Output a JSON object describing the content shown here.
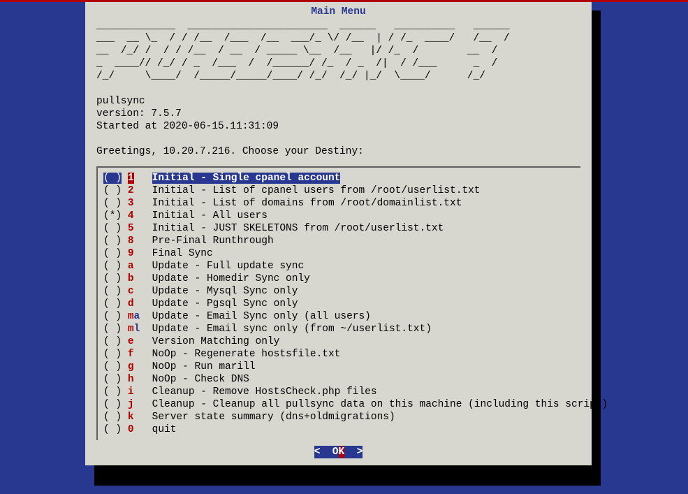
{
  "title": "Main Menu",
  "ascii": [
    "_____________  _______________________  ______   __________   ______",
    "___  __ \\_  / / /__  /___  /__  ___/_ \\/ /__  | / /_  ____/   /__  /",
    "__  /_/ /  / / /__  / __  / _____ \\__  /__   |/ /_  /        __  / ",
    "_  ____// /_/ / _  /___  /  /______/ /_  / _  /|  / /___      _  /  ",
    "/_/     \\____/  /_____/_____/____/ /_/  /_/ |_/  \\____/      /_/   "
  ],
  "app_name": "pullsync",
  "version_label": "version: 7.5.7",
  "started_label": "Started at 2020-06-15.11:31:09",
  "greeting": "Greetings, 10.20.7.216. Choose your Destiny:",
  "menu": [
    {
      "key": "1",
      "key2": "",
      "desc": "Initial - Single cpanel account",
      "selected": true,
      "marked": false
    },
    {
      "key": "2",
      "key2": "",
      "desc": "Initial - List of cpanel users from /root/userlist.txt",
      "selected": false,
      "marked": false
    },
    {
      "key": "3",
      "key2": "",
      "desc": "Initial - List of domains from /root/domainlist.txt",
      "selected": false,
      "marked": false
    },
    {
      "key": "4",
      "key2": "",
      "desc": "Initial - All users",
      "selected": false,
      "marked": true
    },
    {
      "key": "5",
      "key2": "",
      "desc": "Initial - JUST SKELETONS from /root/userlist.txt",
      "selected": false,
      "marked": false
    },
    {
      "key": "8",
      "key2": "",
      "desc": "Pre-Final Runthrough",
      "selected": false,
      "marked": false
    },
    {
      "key": "9",
      "key2": "",
      "desc": "Final Sync",
      "selected": false,
      "marked": false
    },
    {
      "key": "a",
      "key2": "",
      "desc": "Update - Full update sync",
      "selected": false,
      "marked": false
    },
    {
      "key": "b",
      "key2": "",
      "desc": "Update - Homedir Sync only",
      "selected": false,
      "marked": false
    },
    {
      "key": "c",
      "key2": "",
      "desc": "Update - Mysql Sync only",
      "selected": false,
      "marked": false
    },
    {
      "key": "d",
      "key2": "",
      "desc": "Update - Pgsql Sync only",
      "selected": false,
      "marked": false
    },
    {
      "key": "m",
      "key2": "a",
      "desc": "Update - Email Sync only (all users)",
      "selected": false,
      "marked": false
    },
    {
      "key": "m",
      "key2": "l",
      "desc": "Update - Email sync only (from ~/userlist.txt)",
      "selected": false,
      "marked": false
    },
    {
      "key": "e",
      "key2": "",
      "desc": "Version Matching only",
      "selected": false,
      "marked": false
    },
    {
      "key": "f",
      "key2": "",
      "desc": "NoOp - Regenerate hostsfile.txt",
      "selected": false,
      "marked": false
    },
    {
      "key": "g",
      "key2": "",
      "desc": "NoOp - Run marill",
      "selected": false,
      "marked": false
    },
    {
      "key": "h",
      "key2": "",
      "desc": "NoOp - Check DNS",
      "selected": false,
      "marked": false
    },
    {
      "key": "i",
      "key2": "",
      "desc": "Cleanup - Remove HostsCheck.php files",
      "selected": false,
      "marked": false
    },
    {
      "key": "j",
      "key2": "",
      "desc": "Cleanup - Cleanup all pullsync data on this machine (including this script)",
      "selected": false,
      "marked": false
    },
    {
      "key": "k",
      "key2": "",
      "desc": "Server state summary (dns+oldmigrations)",
      "selected": false,
      "marked": false
    },
    {
      "key": "0",
      "key2": "",
      "desc": "quit",
      "selected": false,
      "marked": false
    }
  ],
  "ok_lt": "<  ",
  "ok_o": "O",
  "ok_k": "K",
  "ok_gt": "  >"
}
